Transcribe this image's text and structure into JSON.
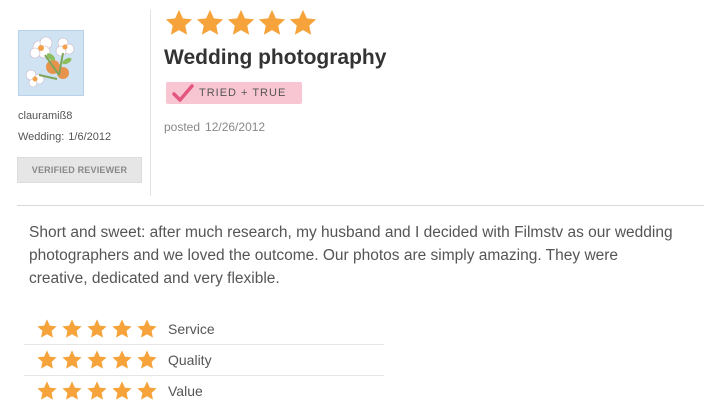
{
  "reviewer": {
    "username": "clauramiß8",
    "wedding_label": "Wedding:",
    "wedding_date": "1/6/2012",
    "verified_label": "VERIFIED REVIEWER"
  },
  "review": {
    "overall_rating": 5,
    "max_rating": 5,
    "title": "Wedding photography",
    "badge_label": "TRIED + TRUE",
    "posted_label": "posted",
    "posted_date": "12/26/2012",
    "body": "Short and sweet: after much research, my husband and I decided with Filmstv as our wedding photographers and we loved the outcome. Our photos are simply amazing. They were creative, dedicated and very flexible."
  },
  "sub_ratings": [
    {
      "label": "Service",
      "rating": 5
    },
    {
      "label": "Quality",
      "rating": 5
    },
    {
      "label": "Value",
      "rating": 5
    }
  ],
  "colors": {
    "star": "#f5a33a",
    "badge_bg": "#f8c6d3",
    "check": "#e3567f"
  }
}
